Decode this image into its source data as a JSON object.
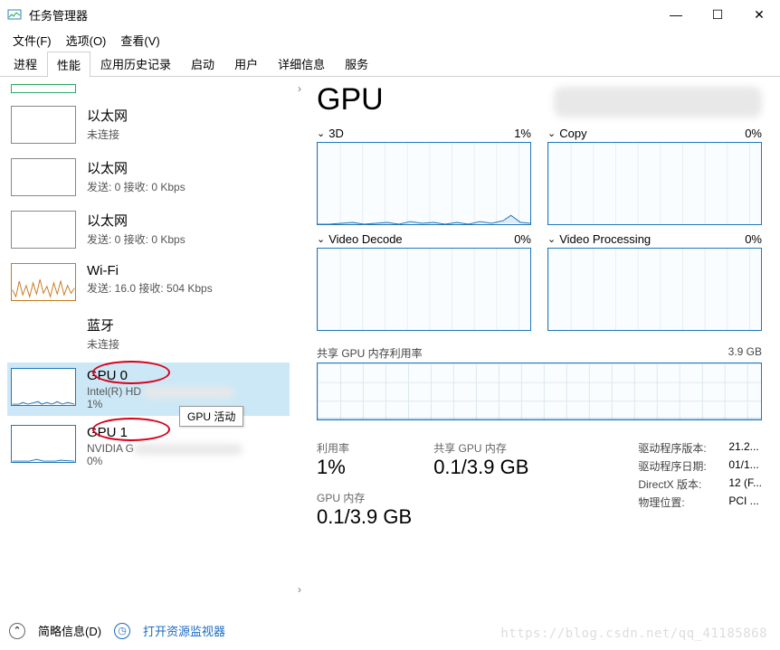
{
  "window": {
    "title": "任务管理器"
  },
  "menu": {
    "file": "文件(F)",
    "options": "选项(O)",
    "view": "查看(V)"
  },
  "tabs": [
    "进程",
    "性能",
    "应用历史记录",
    "启动",
    "用户",
    "详细信息",
    "服务"
  ],
  "active_tab": 1,
  "sidebar": {
    "items": [
      {
        "name": "以太网",
        "sub": "未连接",
        "thumb_kind": "flat"
      },
      {
        "name": "以太网",
        "sub": "发送: 0 接收: 0 Kbps",
        "thumb_kind": "flat"
      },
      {
        "name": "以太网",
        "sub": "发送: 0 接收: 0 Kbps",
        "thumb_kind": "flat"
      },
      {
        "name": "Wi-Fi",
        "sub": "发送: 16.0 接收: 504 Kbps",
        "thumb_kind": "wifi"
      },
      {
        "name": "蓝牙",
        "sub": "未连接",
        "thumb_kind": "none"
      },
      {
        "name": "GPU 0",
        "sub": "Intel(R) HD",
        "sub2": "1%",
        "thumb_kind": "gpu0",
        "selected": true,
        "circled": true
      },
      {
        "name": "GPU 1",
        "sub": "NVIDIA G",
        "sub2": "0%",
        "thumb_kind": "gpu1",
        "circled": true
      }
    ],
    "tooltip": "GPU 活动"
  },
  "right": {
    "title": "GPU",
    "charts": [
      {
        "name": "3D",
        "value": "1%"
      },
      {
        "name": "Copy",
        "value": "0%"
      },
      {
        "name": "Video Decode",
        "value": "0%"
      },
      {
        "name": "Video Processing",
        "value": "0%"
      }
    ],
    "memory": {
      "label": "共享 GPU 内存利用率",
      "max": "3.9 GB"
    },
    "stats": {
      "util_label": "利用率",
      "util": "1%",
      "shared_label": "共享 GPU 内存",
      "shared": "0.1/3.9 GB",
      "gpumem_label": "GPU 内存",
      "gpumem": "0.1/3.9 GB",
      "details": [
        {
          "k": "驱动程序版本:",
          "v": "21.2..."
        },
        {
          "k": "驱动程序日期:",
          "v": "01/1..."
        },
        {
          "k": "DirectX 版本:",
          "v": "12 (F..."
        },
        {
          "k": "物理位置:",
          "v": "PCI ..."
        }
      ]
    }
  },
  "footer": {
    "brief": "简略信息(D)",
    "resmon": "打开资源监视器"
  },
  "watermark": "https://blog.csdn.net/qq_41185868",
  "chart_data": {
    "type": "area",
    "title": "GPU Utilization",
    "series": [
      {
        "name": "3D",
        "values": [
          0,
          0,
          0,
          0,
          0,
          0,
          0,
          0,
          1,
          2,
          1,
          0,
          1,
          1,
          3,
          0,
          1,
          2,
          1,
          3,
          2,
          1,
          2,
          1,
          1,
          3,
          2,
          4,
          1,
          2,
          1,
          8,
          1
        ],
        "ylim": [
          0,
          100
        ]
      },
      {
        "name": "Copy",
        "values": [
          0,
          0,
          0,
          0,
          0,
          0,
          0,
          0,
          0,
          0,
          0,
          0,
          0,
          0,
          0,
          0,
          0,
          0,
          0,
          0,
          0,
          0,
          0,
          0,
          0,
          0,
          0,
          0,
          0,
          0,
          0,
          0,
          0
        ],
        "ylim": [
          0,
          100
        ]
      },
      {
        "name": "Video Decode",
        "values": [
          0,
          0,
          0,
          0,
          0,
          0,
          0,
          0,
          0,
          0,
          0,
          0,
          0,
          0,
          0,
          0,
          0,
          0,
          0,
          0,
          0,
          0,
          0,
          0,
          0,
          0,
          0,
          0,
          0,
          0,
          0,
          0,
          0
        ],
        "ylim": [
          0,
          100
        ]
      },
      {
        "name": "Video Processing",
        "values": [
          0,
          0,
          0,
          0,
          0,
          0,
          0,
          0,
          0,
          0,
          0,
          0,
          0,
          0,
          0,
          0,
          0,
          0,
          0,
          0,
          0,
          0,
          0,
          0,
          0,
          0,
          0,
          0,
          0,
          0,
          0,
          0,
          0
        ],
        "ylim": [
          0,
          100
        ]
      },
      {
        "name": "Shared GPU Memory",
        "values": [
          0.1,
          0.1,
          0.1,
          0.1,
          0.1,
          0.1,
          0.1,
          0.1,
          0.1,
          0.1,
          0.1,
          0.1,
          0.1,
          0.1,
          0.1,
          0.1,
          0.1,
          0.1,
          0.1,
          0.1,
          0.1,
          0.1,
          0.1,
          0.1,
          0.1,
          0.1,
          0.1,
          0.1,
          0.1,
          0.1,
          0.1,
          0.1,
          0.1
        ],
        "ylim": [
          0,
          3.9
        ]
      }
    ],
    "xlabel": "",
    "ylabel": ""
  }
}
